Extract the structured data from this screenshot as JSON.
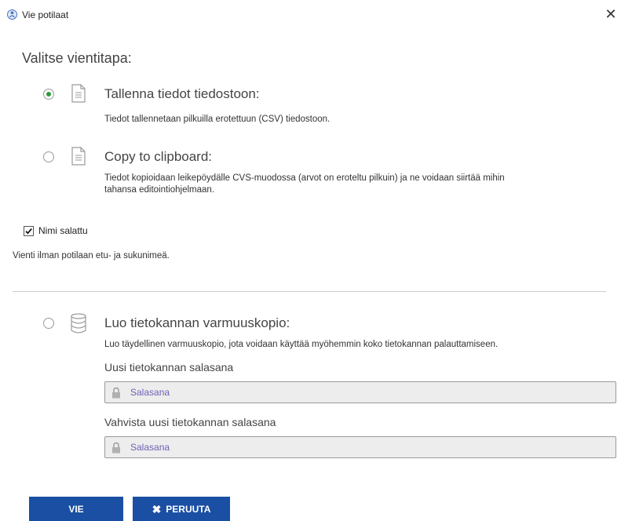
{
  "window": {
    "title": "Vie potilaat",
    "close_symbol": "✕"
  },
  "heading": "Valitse vientitapa:",
  "options": [
    {
      "title": "Tallenna tiedot tiedostoon:",
      "description": "Tiedot tallennetaan pilkuilla erotettuun (CSV) tiedostoon.",
      "icon": "document-icon",
      "checked": true
    },
    {
      "title": "Copy to clipboard:",
      "description_line1": "Tiedot kopioidaan leikepöydälle CVS-muodossa (arvot on eroteltu pilkuin) ja ne voidaan siirtää mihin",
      "description_line2": "tahansa editointiohjelmaan.",
      "icon": "document-icon",
      "checked": false
    }
  ],
  "name_encrypted": {
    "label": "Nimi salattu",
    "checked": true,
    "note": "Vienti ilman potilaan etu- ja sukunimeä."
  },
  "backup": {
    "title": "Luo tietokannan varmuuskopio:",
    "description": "Luo täydellinen varmuuskopio, jota voidaan käyttää myöhemmin koko tietokannan palauttamiseen.",
    "icon": "database-icon",
    "checked": false,
    "new_password_label": "Uusi tietokannan salasana",
    "new_password_placeholder": "Salasana",
    "confirm_password_label": "Vahvista uusi tietokannan salasana",
    "confirm_password_placeholder": "Salasana"
  },
  "buttons": {
    "export_label": "VIE",
    "cancel_label": "PERUUTA",
    "cancel_icon": "✖"
  },
  "colors": {
    "accent": "#1a4fa3",
    "radio_selected": "#2e9b3a",
    "placeholder": "#6b63b5"
  }
}
